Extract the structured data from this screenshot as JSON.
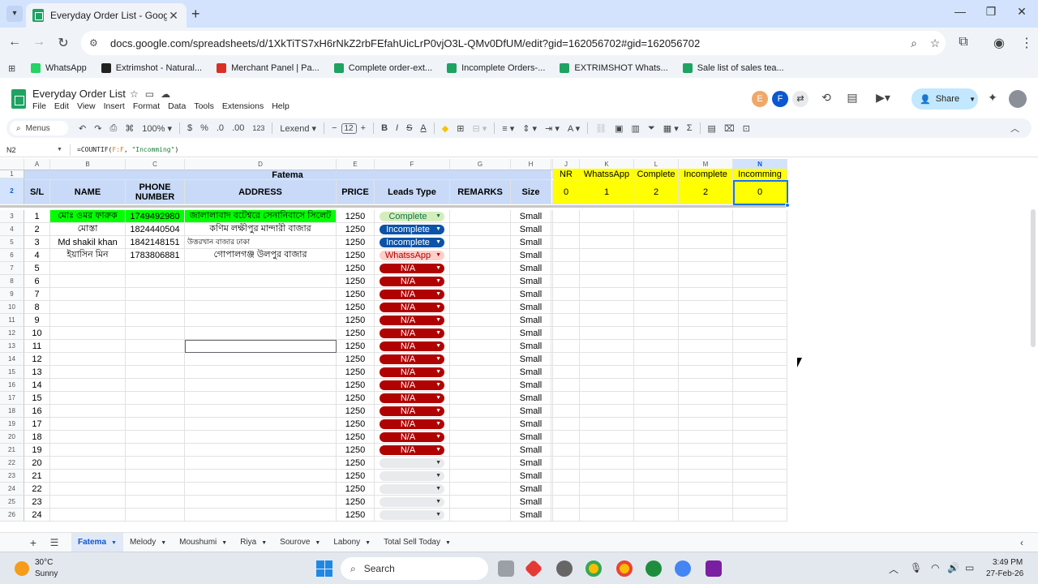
{
  "browser": {
    "tab_title": "Everyday Order List - Google Sh",
    "tab_close": "✕",
    "new_tab": "+",
    "url": "docs.google.com/spreadsheets/d/1XkTiTS7xH6rNkZ2rbFEfahUicLrP0vjO3L-QMv0DfUM/edit?gid=162056702#gid=162056702",
    "bookmarks": [
      {
        "label": "WhatsApp",
        "color": "#25d366"
      },
      {
        "label": "Extrimshot - Natural...",
        "color": "#222222"
      },
      {
        "label": "Merchant Panel | Pa...",
        "color": "#d93025"
      },
      {
        "label": "Complete order-ext...",
        "color": "#1ea362"
      },
      {
        "label": "Incomplete Orders-...",
        "color": "#1ea362"
      },
      {
        "label": "EXTRIMSHOT Whats...",
        "color": "#1ea362"
      },
      {
        "label": "Sale list of sales tea...",
        "color": "#1ea362"
      }
    ]
  },
  "sheets": {
    "doc_title": "Everyday Order List",
    "menu": [
      "File",
      "Edit",
      "View",
      "Insert",
      "Format",
      "Data",
      "Tools",
      "Extensions",
      "Help"
    ],
    "avatars": [
      {
        "letter": "E",
        "color": "#f0a86a"
      },
      {
        "letter": "F",
        "color": "#0b57d0"
      }
    ],
    "share_label": "Share",
    "toolbar": {
      "menus_label": "Menus",
      "zoom": "100%",
      "currency": "$",
      "percent": "%",
      "dec_less": ".0",
      "dec_more": ".00",
      "format_123": "123",
      "font": "Lexend",
      "font_size": "12"
    },
    "name_box": "N2",
    "formula": {
      "prefix": "=COUNTIF(",
      "ref": "F:F",
      "mid": ", ",
      "str": "\"Incomming\"",
      "suffix": ")"
    }
  },
  "grid": {
    "columns": [
      "A",
      "B",
      "C",
      "D",
      "E",
      "F",
      "G",
      "H",
      "I",
      "J",
      "K",
      "L",
      "M",
      "N"
    ],
    "merged_title": "Fatema",
    "headers": {
      "sl": "S/L",
      "name": "NAME",
      "phone": "PHONE NUMBER",
      "address": "ADDRESS",
      "price": "PRICE",
      "leads": "Leads Type",
      "remarks": "REMARKS",
      "size": "Size"
    },
    "summary": {
      "labels": [
        "NR",
        "WhatssApp",
        "Complete",
        "Incomplete",
        "Incomming"
      ],
      "values": [
        "0",
        "1",
        "2",
        "2",
        "0"
      ]
    },
    "rows": [
      {
        "sl": "1",
        "name": "মোঃ ওমর ফারুক",
        "phone": "1749492980",
        "address": "জালালাবাদ বটেশ্বরে সেনানিবাসে সিলেট",
        "price": "1250",
        "lead": "Complete",
        "size": "Small"
      },
      {
        "sl": "2",
        "name": "মোস্তা",
        "phone": "1824440504",
        "address": "কণিম লক্ষীপুর মান্দারী বাজার",
        "price": "1250",
        "lead": "Incomplete",
        "size": "Small"
      },
      {
        "sl": "3",
        "name": "Md shakil khan",
        "phone": "1842148151",
        "address": "উত্তরখান বাজার ঢাকা",
        "price": "1250",
        "lead": "Incomplete",
        "size": "Small"
      },
      {
        "sl": "4",
        "name": "ইয়াসিন মিন",
        "phone": "1783806881",
        "address": "গোপালগঞ্জ উলপুর বাজার",
        "price": "1250",
        "lead": "WhatssApp",
        "size": "Small"
      },
      {
        "sl": "5",
        "name": "",
        "phone": "",
        "address": "",
        "price": "1250",
        "lead": "N/A",
        "size": "Small"
      },
      {
        "sl": "6",
        "name": "",
        "phone": "",
        "address": "",
        "price": "1250",
        "lead": "N/A",
        "size": "Small"
      },
      {
        "sl": "7",
        "name": "",
        "phone": "",
        "address": "",
        "price": "1250",
        "lead": "N/A",
        "size": "Small"
      },
      {
        "sl": "8",
        "name": "",
        "phone": "",
        "address": "",
        "price": "1250",
        "lead": "N/A",
        "size": "Small"
      },
      {
        "sl": "9",
        "name": "",
        "phone": "",
        "address": "",
        "price": "1250",
        "lead": "N/A",
        "size": "Small"
      },
      {
        "sl": "10",
        "name": "",
        "phone": "",
        "address": "",
        "price": "1250",
        "lead": "N/A",
        "size": "Small"
      },
      {
        "sl": "11",
        "name": "",
        "phone": "",
        "address": "",
        "price": "1250",
        "lead": "N/A",
        "size": "Small"
      },
      {
        "sl": "12",
        "name": "",
        "phone": "",
        "address": "",
        "price": "1250",
        "lead": "N/A",
        "size": "Small"
      },
      {
        "sl": "13",
        "name": "",
        "phone": "",
        "address": "",
        "price": "1250",
        "lead": "N/A",
        "size": "Small"
      },
      {
        "sl": "14",
        "name": "",
        "phone": "",
        "address": "",
        "price": "1250",
        "lead": "N/A",
        "size": "Small"
      },
      {
        "sl": "15",
        "name": "",
        "phone": "",
        "address": "",
        "price": "1250",
        "lead": "N/A",
        "size": "Small"
      },
      {
        "sl": "16",
        "name": "",
        "phone": "",
        "address": "",
        "price": "1250",
        "lead": "N/A",
        "size": "Small"
      },
      {
        "sl": "17",
        "name": "",
        "phone": "",
        "address": "",
        "price": "1250",
        "lead": "N/A",
        "size": "Small"
      },
      {
        "sl": "18",
        "name": "",
        "phone": "",
        "address": "",
        "price": "1250",
        "lead": "N/A",
        "size": "Small"
      },
      {
        "sl": "19",
        "name": "",
        "phone": "",
        "address": "",
        "price": "1250",
        "lead": "N/A",
        "size": "Small"
      },
      {
        "sl": "20",
        "name": "",
        "phone": "",
        "address": "",
        "price": "1250",
        "lead": "",
        "size": "Small"
      },
      {
        "sl": "21",
        "name": "",
        "phone": "",
        "address": "",
        "price": "1250",
        "lead": "",
        "size": "Small"
      },
      {
        "sl": "22",
        "name": "",
        "phone": "",
        "address": "",
        "price": "1250",
        "lead": "",
        "size": "Small"
      },
      {
        "sl": "23",
        "name": "",
        "phone": "",
        "address": "",
        "price": "1250",
        "lead": "",
        "size": "Small"
      },
      {
        "sl": "24",
        "name": "",
        "phone": "",
        "address": "",
        "price": "1250",
        "lead": "",
        "size": "Small"
      }
    ]
  },
  "sheet_tabs": [
    "Fatema",
    "Melody",
    "Moushumi",
    "Riya",
    "Sourove",
    "Labony",
    "Total Sell Today"
  ],
  "taskbar": {
    "temp": "30°C",
    "weather": "Sunny",
    "search_label": "Search",
    "time": "3:49 PM",
    "date": "27-Feb-26"
  }
}
